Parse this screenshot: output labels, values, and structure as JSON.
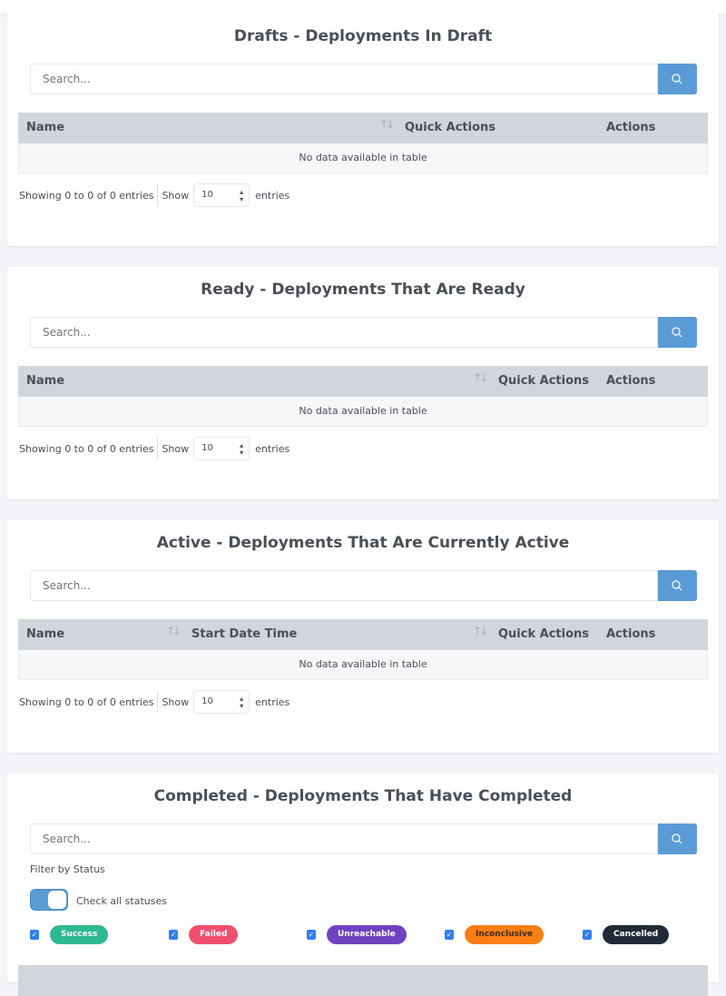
{
  "sections": [
    {
      "title": "Drafts - Deployments In Draft",
      "search_placeholder": "Search...",
      "columns": [
        "Name",
        "Quick Actions",
        "Actions"
      ],
      "empty": "No data available in table",
      "info": "Showing 0 to 0 of 0 entries",
      "show": "Show",
      "page_size": "10",
      "entries": "entries"
    },
    {
      "title": "Ready - Deployments That Are Ready",
      "search_placeholder": "Search...",
      "columns": [
        "Name",
        "Quick Actions",
        "Actions"
      ],
      "empty": "No data available in table",
      "info": "Showing 0 to 0 of 0 entries",
      "show": "Show",
      "page_size": "10",
      "entries": "entries"
    },
    {
      "title": "Active - Deployments That Are Currently Active",
      "search_placeholder": "Search...",
      "columns": [
        "Name",
        "Start Date Time",
        "Quick Actions",
        "Actions"
      ],
      "empty": "No data available in table",
      "info": "Showing 0 to 0 of 0 entries",
      "show": "Show",
      "page_size": "10",
      "entries": "entries"
    },
    {
      "title": "Completed - Deployments That Have Completed",
      "search_placeholder": "Search...",
      "filter_label": "Filter by Status",
      "check_all": "Check all statuses",
      "check_all_on": true,
      "statuses": [
        {
          "label": "Success",
          "color": "#2fb98e",
          "checked": true
        },
        {
          "label": "Failed",
          "color": "#f0506e",
          "checked": true
        },
        {
          "label": "Unreachable",
          "color": "#6f42c1",
          "checked": true
        },
        {
          "label": "Inconclusive",
          "color": "#fd7e14",
          "checked": true
        },
        {
          "label": "Cancelled",
          "color": "#212b36",
          "checked": true
        }
      ]
    }
  ],
  "colors": {
    "accent": "#5b9bd5",
    "table_header": "#d1d5dc"
  }
}
